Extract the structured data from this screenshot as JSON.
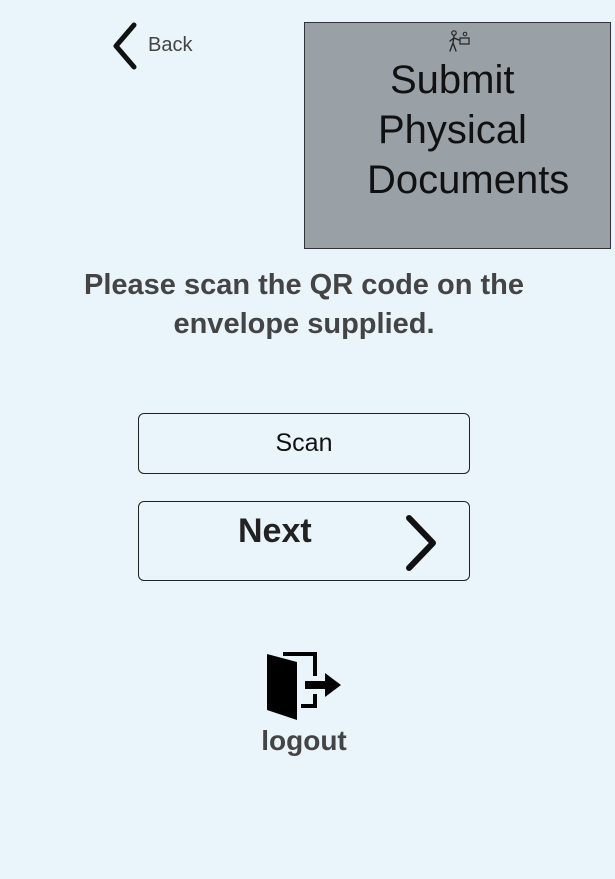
{
  "header": {
    "back_label": "Back",
    "back_icon": "chevron-left-icon",
    "title_lines": [
      "Submit",
      "Physical",
      "Documents"
    ],
    "title_icon": "person-delivering-icon",
    "title_bg": "#9aa1a6"
  },
  "main": {
    "instruction": "Please scan the QR code on the envelope supplied.",
    "scan_label": "Scan",
    "next_label": "Next",
    "next_icon": "chevron-right-icon"
  },
  "footer": {
    "logout_label": "logout",
    "logout_icon": "exit-door-icon"
  },
  "colors": {
    "background": "#e9f4fb",
    "text_dark": "#222222",
    "text_muted": "#444444"
  }
}
